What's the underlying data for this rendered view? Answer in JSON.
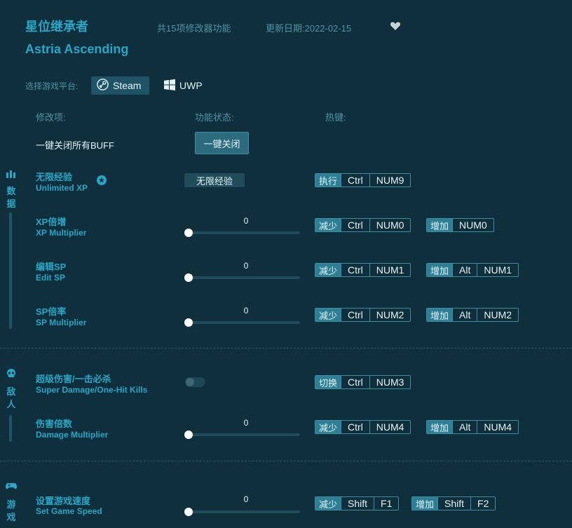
{
  "header": {
    "title_cn": "星位继承者",
    "title_en": "Astria Ascending",
    "feature_count": "共15项修改器功能",
    "update_date": "更新日期:2022-02-15"
  },
  "platform": {
    "label": "选择游戏平台:",
    "options": [
      "Steam",
      "UWP"
    ],
    "selected": "Steam"
  },
  "columns": {
    "item": "修改项:",
    "status": "功能状态:",
    "hotkey": "热键:"
  },
  "global": {
    "label": "一键关闭所有BUFF",
    "button": "一键关闭"
  },
  "categories": [
    {
      "name": "数据",
      "chars": [
        "数",
        "据"
      ],
      "icon": "bar-chart-icon"
    },
    {
      "name": "敌人",
      "chars": [
        "敌",
        "人"
      ],
      "icon": "skull-icon"
    },
    {
      "name": "游戏",
      "chars": [
        "游",
        "戏"
      ],
      "icon": "gamepad-icon"
    }
  ],
  "items": [
    {
      "cn": "无限经验",
      "en": "Unlimited XP",
      "control": "button",
      "control_label": "无限经验",
      "hotkeys": [
        {
          "action": "执行",
          "keys": [
            "Ctrl",
            "NUM9"
          ]
        }
      ]
    },
    {
      "cn": "XP倍增",
      "en": "XP Multiplier",
      "control": "slider",
      "value": "0",
      "hotkeys": [
        {
          "action": "减少",
          "keys": [
            "Ctrl",
            "NUM0"
          ]
        },
        {
          "action": "增加",
          "keys": [
            "NUM0"
          ]
        }
      ]
    },
    {
      "cn": "编辑SP",
      "en": "Edit SP",
      "control": "slider",
      "value": "0",
      "hotkeys": [
        {
          "action": "减少",
          "keys": [
            "Ctrl",
            "NUM1"
          ]
        },
        {
          "action": "增加",
          "keys": [
            "Alt",
            "NUM1"
          ]
        }
      ]
    },
    {
      "cn": "SP倍率",
      "en": "SP Multiplier",
      "control": "slider",
      "value": "0",
      "hotkeys": [
        {
          "action": "减少",
          "keys": [
            "Ctrl",
            "NUM2"
          ]
        },
        {
          "action": "增加",
          "keys": [
            "Alt",
            "NUM2"
          ]
        }
      ]
    },
    {
      "cn": "超级伤害/一击必杀",
      "en": "Super Damage/One-Hit Kills",
      "control": "toggle",
      "toggle_on": false,
      "hotkeys": [
        {
          "action": "切换",
          "keys": [
            "Ctrl",
            "NUM3"
          ]
        }
      ]
    },
    {
      "cn": "伤害倍数",
      "en": "Damage Multiplier",
      "control": "slider",
      "value": "0",
      "hotkeys": [
        {
          "action": "减少",
          "keys": [
            "Ctrl",
            "NUM4"
          ]
        },
        {
          "action": "增加",
          "keys": [
            "Alt",
            "NUM4"
          ]
        }
      ]
    },
    {
      "cn": "设置游戏速度",
      "en": "Set Game Speed",
      "control": "slider",
      "value": "0",
      "hotkeys": [
        {
          "action": "减少",
          "keys": [
            "Shift",
            "F1"
          ]
        },
        {
          "action": "增加",
          "keys": [
            "Shift",
            "F2"
          ]
        }
      ]
    }
  ],
  "colors": {
    "background": "#0e2f3b",
    "accent": "#2aa6c6",
    "action_badge": "#2c7f95"
  }
}
